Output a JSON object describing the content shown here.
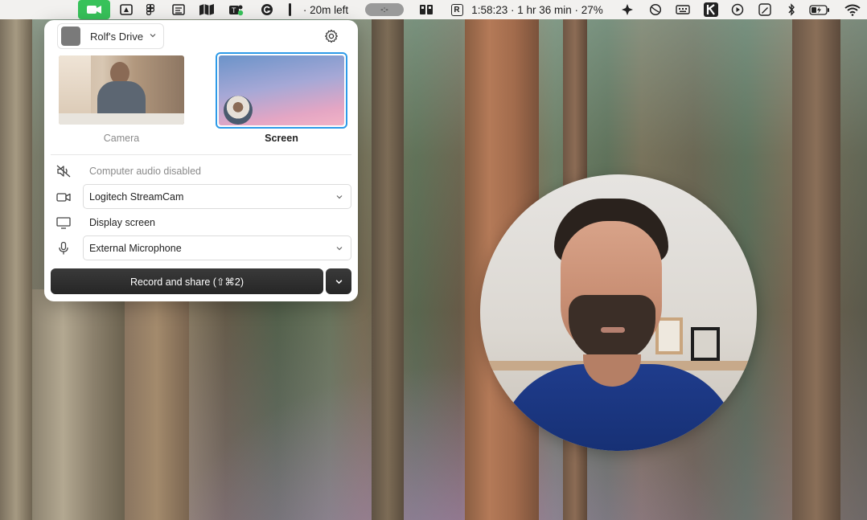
{
  "menubar": {
    "time_left": "· 20m left",
    "pill_text": "-:-",
    "r_badge": "R",
    "status_text": "1:58:23 · 1 hr 36 min · 27%",
    "icons": [
      "camera-icon",
      "drive-icon",
      "figma-icon",
      "notes-icon",
      "maps-icon",
      "teams-icon",
      "grammarly-icon",
      "divider-icon",
      "pill-icon",
      "books-icon",
      "r-icon",
      "cursor-icon",
      "circle-icon",
      "keyboard-icon",
      "k-icon",
      "play-icon",
      "pen-icon",
      "bluetooth-icon",
      "battery-icon",
      "wifi-icon"
    ],
    "accent": "#37c25a"
  },
  "panel": {
    "drive_label": "Rolf's Drive",
    "sources": {
      "camera_label": "Camera",
      "screen_label": "Screen",
      "selected": "Screen"
    },
    "audio_label": "Computer audio disabled",
    "camera_select": "Logitech StreamCam",
    "display_label": "Display screen",
    "mic_select": "External Microphone",
    "record_label": "Record and share (⇧⌘2)",
    "selection_color": "#2d9ae8"
  }
}
